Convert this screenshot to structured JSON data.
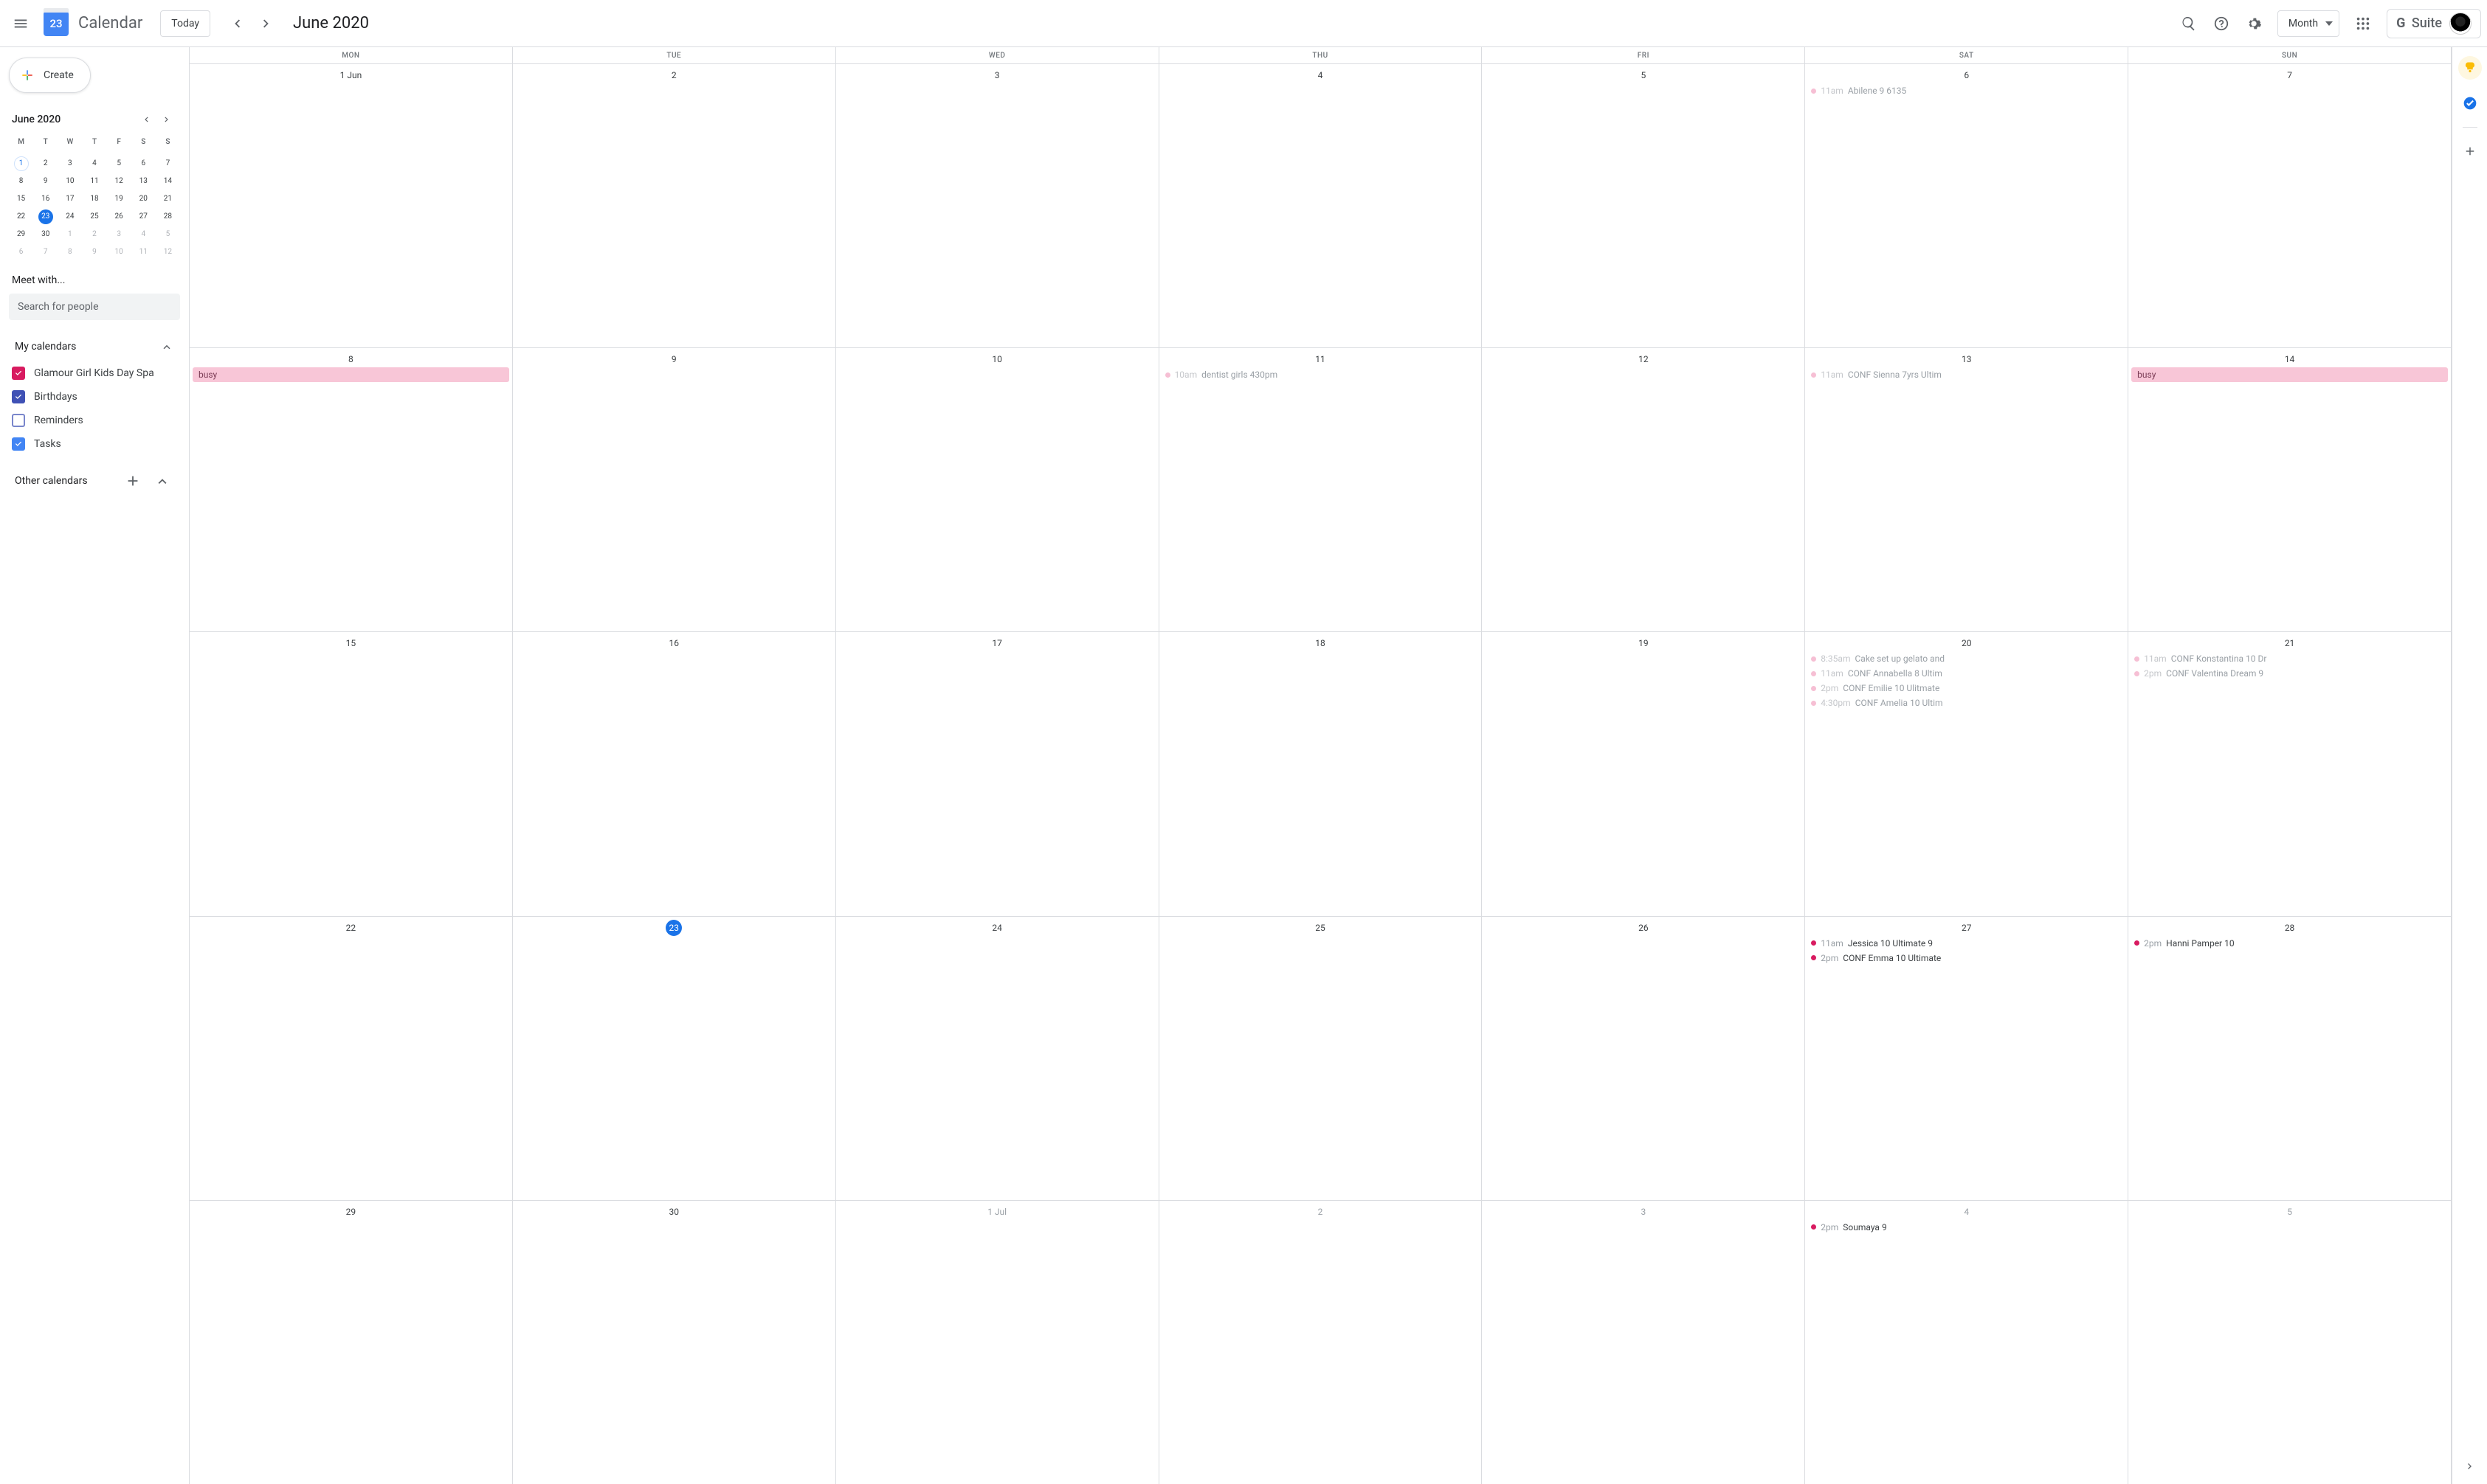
{
  "header": {
    "app_name": "Calendar",
    "logo_day": "23",
    "today_label": "Today",
    "period_title": "June 2020",
    "view_label": "Month",
    "gsuite_label": "G Suite"
  },
  "sidebar": {
    "create_label": "Create",
    "mini_title": "June 2020",
    "dows": [
      "M",
      "T",
      "W",
      "T",
      "F",
      "S",
      "S"
    ],
    "days": [
      {
        "n": "1",
        "selected": true
      },
      {
        "n": "2"
      },
      {
        "n": "3"
      },
      {
        "n": "4"
      },
      {
        "n": "5"
      },
      {
        "n": "6"
      },
      {
        "n": "7"
      },
      {
        "n": "8"
      },
      {
        "n": "9"
      },
      {
        "n": "10"
      },
      {
        "n": "11"
      },
      {
        "n": "12"
      },
      {
        "n": "13"
      },
      {
        "n": "14"
      },
      {
        "n": "15"
      },
      {
        "n": "16"
      },
      {
        "n": "17"
      },
      {
        "n": "18"
      },
      {
        "n": "19"
      },
      {
        "n": "20"
      },
      {
        "n": "21"
      },
      {
        "n": "22"
      },
      {
        "n": "23",
        "today": true
      },
      {
        "n": "24"
      },
      {
        "n": "25"
      },
      {
        "n": "26"
      },
      {
        "n": "27"
      },
      {
        "n": "28"
      },
      {
        "n": "29"
      },
      {
        "n": "30"
      },
      {
        "n": "1",
        "dim": true
      },
      {
        "n": "2",
        "dim": true
      },
      {
        "n": "3",
        "dim": true
      },
      {
        "n": "4",
        "dim": true
      },
      {
        "n": "5",
        "dim": true
      },
      {
        "n": "6",
        "dim": true
      },
      {
        "n": "7",
        "dim": true
      },
      {
        "n": "8",
        "dim": true
      },
      {
        "n": "9",
        "dim": true
      },
      {
        "n": "10",
        "dim": true
      },
      {
        "n": "11",
        "dim": true
      },
      {
        "n": "12",
        "dim": true
      }
    ],
    "meet_title": "Meet with...",
    "search_placeholder": "Search for people",
    "my_calendars_title": "My calendars",
    "calendars": [
      {
        "label": "Glamour Girl Kids Day Spa",
        "color": "#d81b60",
        "checked": true
      },
      {
        "label": "Birthdays",
        "color": "#3f51b5",
        "checked": true
      },
      {
        "label": "Reminders",
        "color": "#7986cb",
        "checked": false
      },
      {
        "label": "Tasks",
        "color": "#4285f4",
        "checked": true
      }
    ],
    "other_calendars_title": "Other calendars"
  },
  "grid": {
    "dows": [
      "MON",
      "TUE",
      "WED",
      "THU",
      "FRI",
      "SAT",
      "SUN"
    ],
    "weeks": [
      [
        {
          "label": "1 Jun",
          "events": []
        },
        {
          "label": "2",
          "events": []
        },
        {
          "label": "3",
          "events": []
        },
        {
          "label": "4",
          "events": []
        },
        {
          "label": "5",
          "events": []
        },
        {
          "label": "6",
          "events": [
            {
              "time": "11am",
              "title": "Abilene 9 6135",
              "kind": "past"
            }
          ]
        },
        {
          "label": "7",
          "events": []
        }
      ],
      [
        {
          "label": "8",
          "events": [
            {
              "title": "busy",
              "kind": "block"
            }
          ]
        },
        {
          "label": "9",
          "events": []
        },
        {
          "label": "10",
          "events": []
        },
        {
          "label": "11",
          "events": [
            {
              "time": "10am",
              "title": "dentist girls 430pm",
              "kind": "past"
            }
          ]
        },
        {
          "label": "12",
          "events": []
        },
        {
          "label": "13",
          "events": [
            {
              "time": "11am",
              "title": "CONF Sienna 7yrs Ultim",
              "kind": "past"
            }
          ]
        },
        {
          "label": "14",
          "events": [
            {
              "title": "busy",
              "kind": "block"
            }
          ]
        }
      ],
      [
        {
          "label": "15",
          "events": []
        },
        {
          "label": "16",
          "events": []
        },
        {
          "label": "17",
          "events": []
        },
        {
          "label": "18",
          "events": []
        },
        {
          "label": "19",
          "events": []
        },
        {
          "label": "20",
          "events": [
            {
              "time": "8:35am",
              "title": "Cake set up gelato and",
              "kind": "past"
            },
            {
              "time": "11am",
              "title": "CONF Annabella 8 Ultim",
              "kind": "past"
            },
            {
              "time": "2pm",
              "title": "CONF Emilie 10 Ulitmate",
              "kind": "past"
            },
            {
              "time": "4:30pm",
              "title": "CONF Amelia 10 Ultim",
              "kind": "past"
            }
          ]
        },
        {
          "label": "21",
          "events": [
            {
              "time": "11am",
              "title": "CONF Konstantina 10 Dr",
              "kind": "past"
            },
            {
              "time": "2pm",
              "title": "CONF Valentina Dream 9",
              "kind": "past"
            }
          ]
        }
      ],
      [
        {
          "label": "22",
          "events": []
        },
        {
          "label": "23",
          "today": true,
          "events": []
        },
        {
          "label": "24",
          "events": []
        },
        {
          "label": "25",
          "events": []
        },
        {
          "label": "26",
          "events": []
        },
        {
          "label": "27",
          "events": [
            {
              "time": "11am",
              "title": "Jessica 10 Ultimate 9",
              "kind": "future"
            },
            {
              "time": "2pm",
              "title": "CONF Emma 10 Ultimate",
              "kind": "future"
            }
          ]
        },
        {
          "label": "28",
          "events": [
            {
              "time": "2pm",
              "title": "Hanni Pamper 10",
              "kind": "future"
            }
          ]
        }
      ],
      [
        {
          "label": "29",
          "events": []
        },
        {
          "label": "30",
          "events": []
        },
        {
          "label": "1 Jul",
          "dim": true,
          "events": []
        },
        {
          "label": "2",
          "dim": true,
          "events": []
        },
        {
          "label": "3",
          "dim": true,
          "events": []
        },
        {
          "label": "4",
          "dim": true,
          "events": [
            {
              "time": "2pm",
              "title": "Soumaya 9",
              "kind": "future"
            }
          ]
        },
        {
          "label": "5",
          "dim": true,
          "events": []
        }
      ]
    ]
  }
}
